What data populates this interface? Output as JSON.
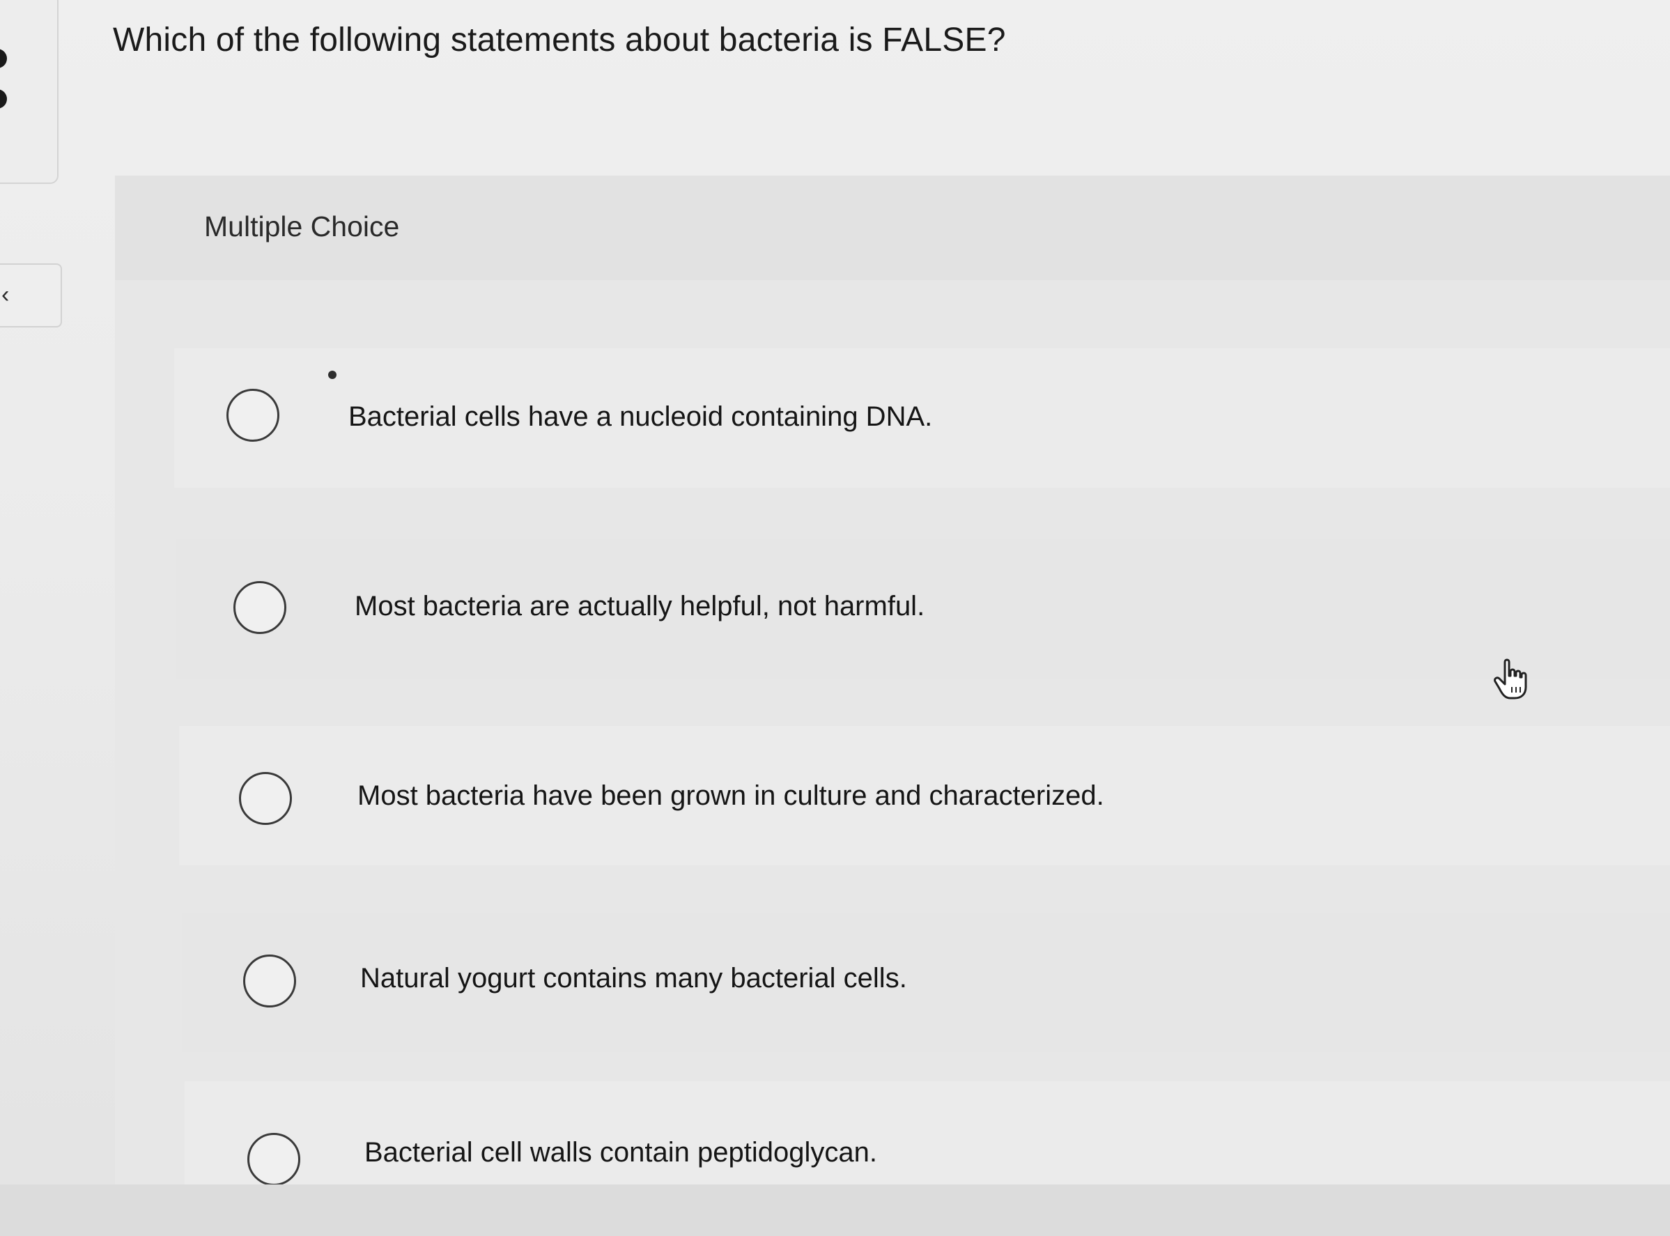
{
  "question": {
    "title": "Which of the following statements about bacteria is FALSE?"
  },
  "panel": {
    "label": "Multiple Choice"
  },
  "choices": [
    {
      "label": "Bacterial cells have a nucleoid containing DNA.",
      "selected": false
    },
    {
      "label": "Most bacteria are actually helpful, not harmful.",
      "selected": false
    },
    {
      "label": "Most bacteria have been grown in culture and characterized.",
      "selected": false
    },
    {
      "label": "Natural yogurt contains many bacterial cells.",
      "selected": false
    },
    {
      "label": "Bacterial cell walls contain peptidoglycan.",
      "selected": false
    }
  ],
  "nav": {
    "collapse_icon": "chevron-left-icon",
    "collapse_glyph": "‹"
  },
  "cursor": {
    "icon": "hand-pointer-icon"
  },
  "colors": {
    "background": "#ececec",
    "panel": "#e7e7e7",
    "text": "#1a1a1a",
    "radio_border": "#3a3a3a"
  }
}
